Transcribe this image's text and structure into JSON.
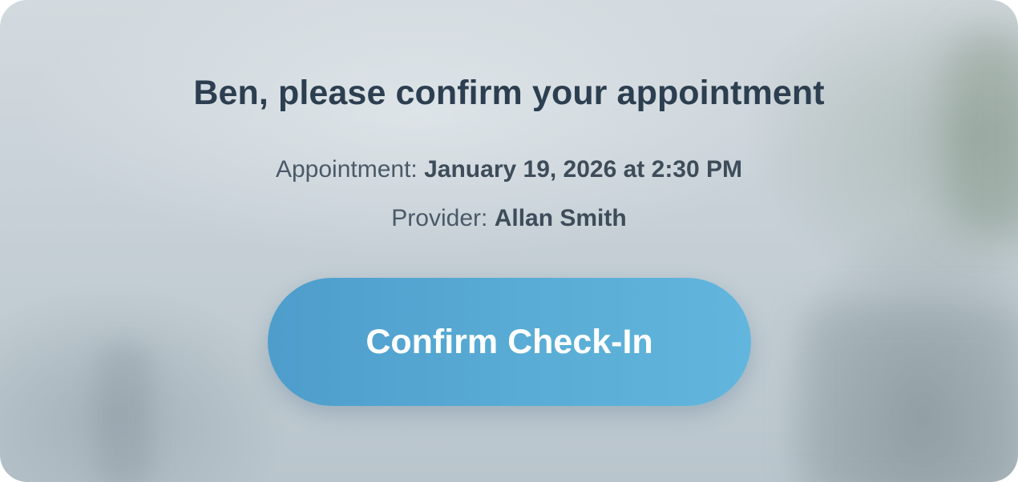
{
  "heading": "Ben, please confirm your appointment",
  "appointment": {
    "label": "Appointment: ",
    "value": "January 19, 2026 at 2:30 PM"
  },
  "provider": {
    "label": "Provider: ",
    "value": "Allan Smith"
  },
  "confirm_button": {
    "label": "Confirm Check-In"
  },
  "colors": {
    "heading": "#2c3e50",
    "button_start": "#4e9dcc",
    "button_end": "#62b6de",
    "button_text": "#ffffff"
  }
}
